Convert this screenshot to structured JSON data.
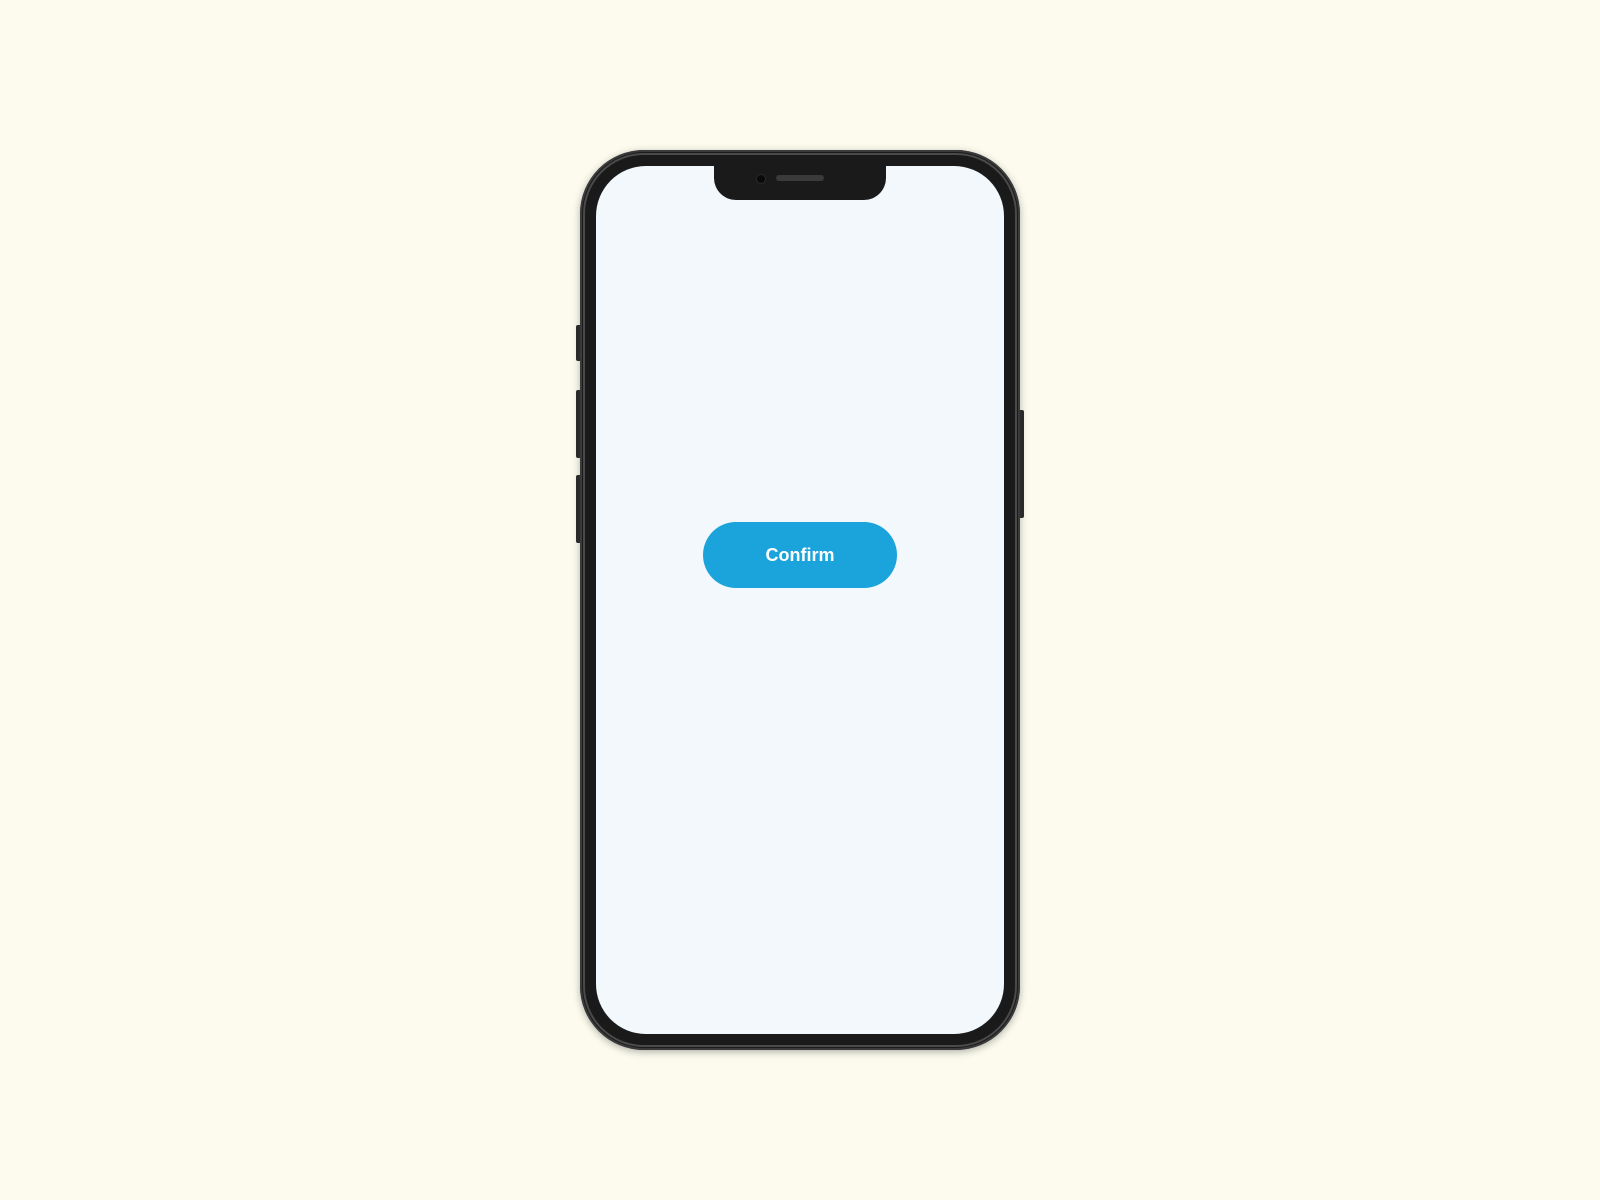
{
  "screen": {
    "confirm_label": "Confirm"
  },
  "colors": {
    "accent": "#1ba3dc",
    "background": "#f2f8fb",
    "page_background": "#fcfbee"
  }
}
